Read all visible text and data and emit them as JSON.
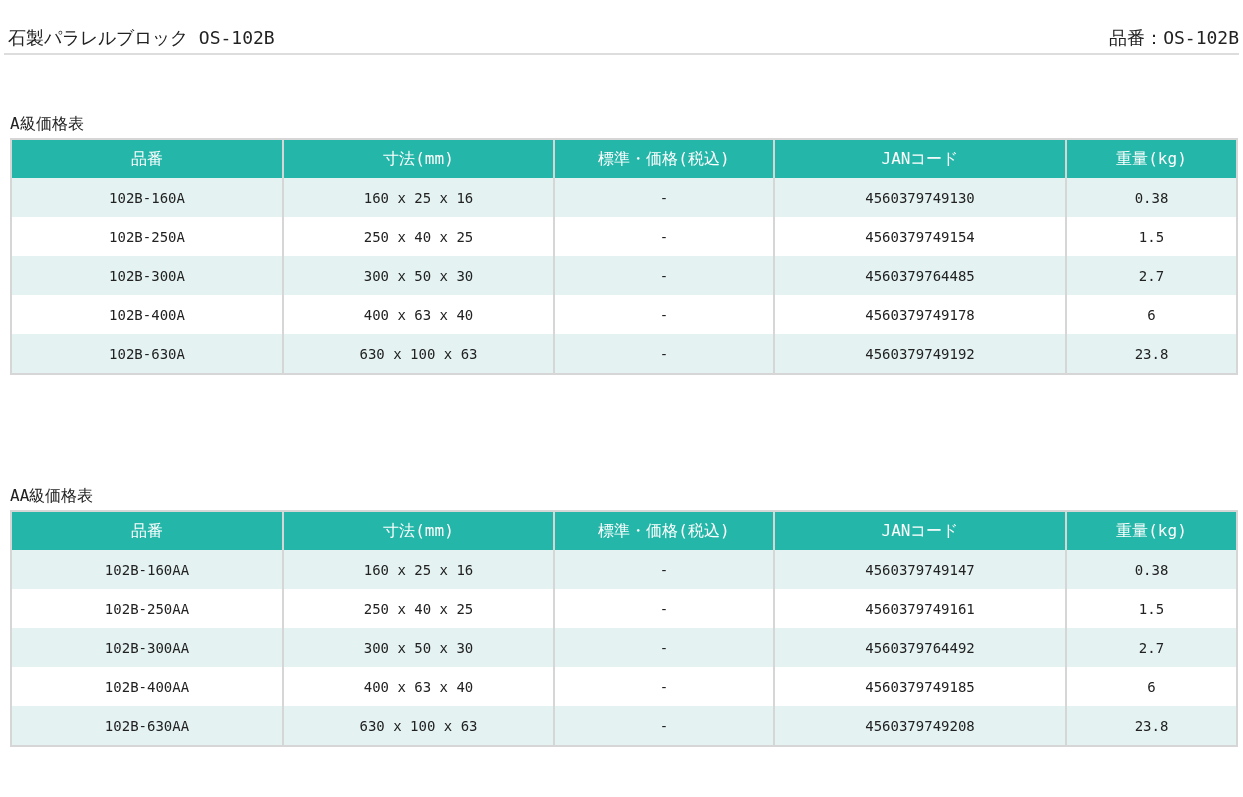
{
  "header": {
    "title": "石製パラレルブロック OS-102B",
    "product_number": "品番：OS-102B"
  },
  "tables": [
    {
      "title": "A級価格表",
      "columns": [
        "品番",
        "寸法(mm)",
        "標準・価格(税込)",
        "JANコード",
        "重量(kg)"
      ],
      "rows": [
        [
          "102B-160A",
          "160 x 25 x 16",
          "-",
          "4560379749130",
          "0.38"
        ],
        [
          "102B-250A",
          "250 x 40 x 25",
          "-",
          "4560379749154",
          "1.5"
        ],
        [
          "102B-300A",
          "300 x 50 x 30",
          "-",
          "4560379764485",
          "2.7"
        ],
        [
          "102B-400A",
          "400 x 63 x 40",
          "-",
          "4560379749178",
          "6"
        ],
        [
          "102B-630A",
          "630 x 100 x 63",
          "-",
          "4560379749192",
          "23.8"
        ]
      ]
    },
    {
      "title": "AA級価格表",
      "columns": [
        "品番",
        "寸法(mm)",
        "標準・価格(税込)",
        "JANコード",
        "重量(kg)"
      ],
      "rows": [
        [
          "102B-160AA",
          "160 x 25 x 16",
          "-",
          "4560379749147",
          "0.38"
        ],
        [
          "102B-250AA",
          "250 x 40 x 25",
          "-",
          "4560379749161",
          "1.5"
        ],
        [
          "102B-300AA",
          "300 x 50 x 30",
          "-",
          "4560379764492",
          "2.7"
        ],
        [
          "102B-400AA",
          "400 x 63 x 40",
          "-",
          "4560379749185",
          "6"
        ],
        [
          "102B-630AA",
          "630 x 100 x 63",
          "-",
          "4560379749208",
          "23.8"
        ]
      ]
    }
  ]
}
